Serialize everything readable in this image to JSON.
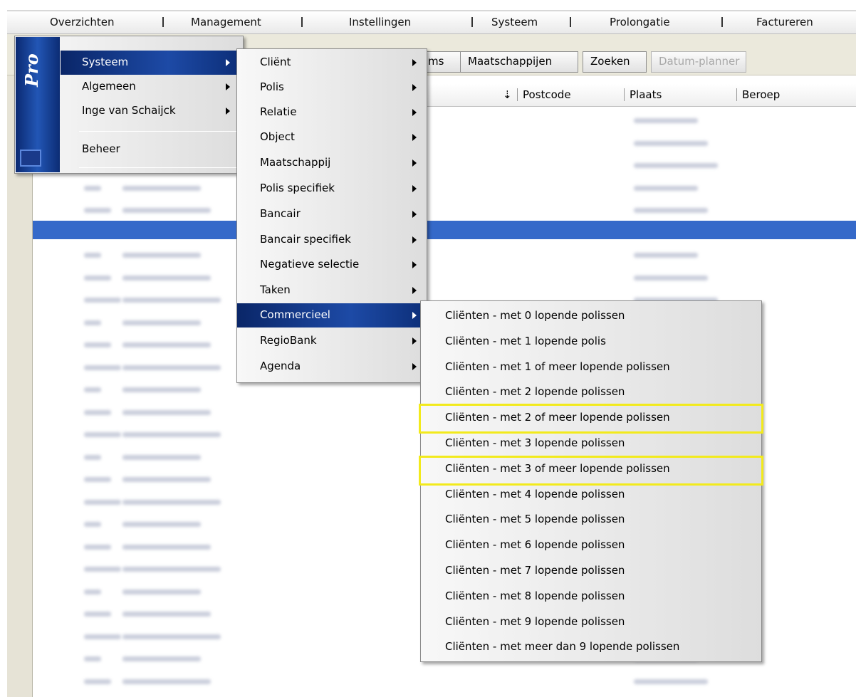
{
  "menubar": {
    "items": [
      "Overzichten",
      "Management",
      "Instellingen",
      "Systeem",
      "Prolongatie",
      "Factureren"
    ]
  },
  "toolbar": {
    "tabs": [
      "ms",
      "Maatschappijen",
      "Zoeken",
      "Datum-planner"
    ]
  },
  "grid": {
    "columns": [
      "Postcode",
      "Plaats",
      "Beroep"
    ]
  },
  "pro_bar": {
    "label": "Pro"
  },
  "main_menu": {
    "items": [
      "Systeem",
      "Algemeen",
      "Inge van Schaijck",
      "Beheer"
    ]
  },
  "systeem_menu": {
    "items": [
      "Cliënt",
      "Polis",
      "Relatie",
      "Object",
      "Maatschappij",
      "Polis specifiek",
      "Bancair",
      "Bancair specifiek",
      "Negatieve selectie",
      "Taken",
      "Commercieel",
      "RegioBank",
      "Agenda"
    ]
  },
  "commercieel_menu": {
    "items": [
      "Cliënten - met 0 lopende polissen",
      "Cliënten - met 1 lopende polis",
      "Cliënten - met 1 of meer lopende polissen",
      "Cliënten - met 2 lopende polissen",
      "Cliënten - met 2 of meer lopende polissen",
      "Cliënten - met 3 lopende polissen",
      "Cliënten - met 3 of meer lopende polissen",
      "Cliënten - met 4 lopende polissen",
      "Cliënten - met 5 lopende polissen",
      "Cliënten - met 6 lopende polissen",
      "Cliënten - met 7 lopende polissen",
      "Cliënten - met 8 lopende polissen",
      "Cliënten - met 9 lopende polissen",
      "Cliënten - met meer dan 9 lopende polissen"
    ]
  },
  "colors": {
    "accent": "#1d4aa6",
    "highlight": "#f2ea1c",
    "selected_row": "#3569c9"
  }
}
